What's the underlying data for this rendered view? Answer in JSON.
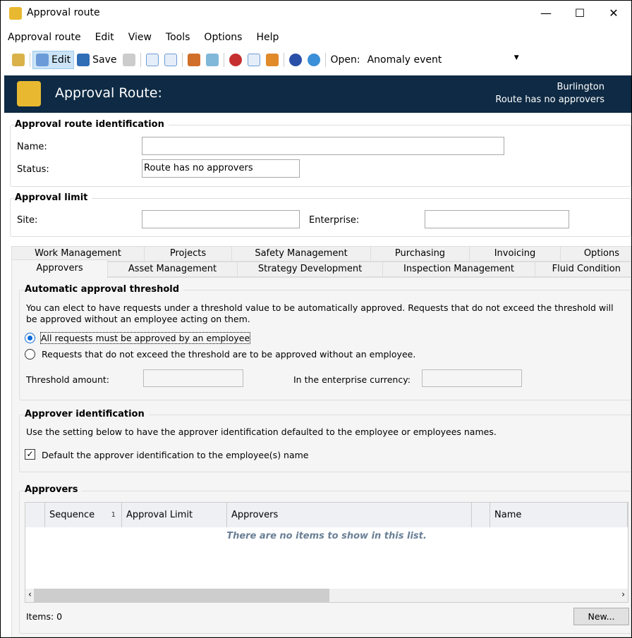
{
  "window": {
    "title": "Approval route",
    "minimize": "—",
    "maximize": "☐",
    "close": "✕"
  },
  "menu": [
    "Approval route",
    "Edit",
    "View",
    "Tools",
    "Options",
    "Help"
  ],
  "toolbar": {
    "edit": "Edit",
    "save": "Save",
    "open_label": "Open:",
    "open_value": "Anomaly event"
  },
  "header": {
    "title": "Approval Route:",
    "site": "Burlington",
    "status": "Route has no approvers"
  },
  "identification": {
    "title": "Approval route identification",
    "name_label": "Name:",
    "name_value": "",
    "status_label": "Status:",
    "status_value": "Route has no approvers"
  },
  "limit": {
    "title": "Approval limit",
    "site_label": "Site:",
    "site_value": "",
    "enterprise_label": "Enterprise:",
    "enterprise_value": ""
  },
  "tabs_row1": [
    "Work Management",
    "Projects",
    "Safety Management",
    "Purchasing",
    "Invoicing",
    "Options"
  ],
  "tabs_row2": [
    "Approvers",
    "Asset Management",
    "Strategy Development",
    "Inspection Management",
    "Fluid Condition"
  ],
  "threshold": {
    "title": "Automatic approval threshold",
    "desc": "You can elect to have requests under a threshold value to be automatically approved.  Requests that do not exceed the threshold will be approved without an employee acting on them.",
    "option1": "All requests must be approved by an employee",
    "option2": "Requests that do not exceed the threshold are to be approved without an employee.",
    "selected": 1,
    "amount_label": "Threshold amount:",
    "currency_label": "In the enterprise currency:"
  },
  "approver_id": {
    "title": "Approver identification",
    "desc": "Use the setting below to have the approver identification defaulted to the employee or employees names.",
    "checkbox": "Default the approver identification to the employee(s) name",
    "checked": true
  },
  "approvers": {
    "title": "Approvers",
    "columns": [
      "Sequence",
      "Approval Limit",
      "Approvers",
      "",
      "Name"
    ],
    "sort_indicator": "1",
    "empty": "There are no items to show in this list.",
    "items": "Items: 0",
    "new_button": "New..."
  }
}
